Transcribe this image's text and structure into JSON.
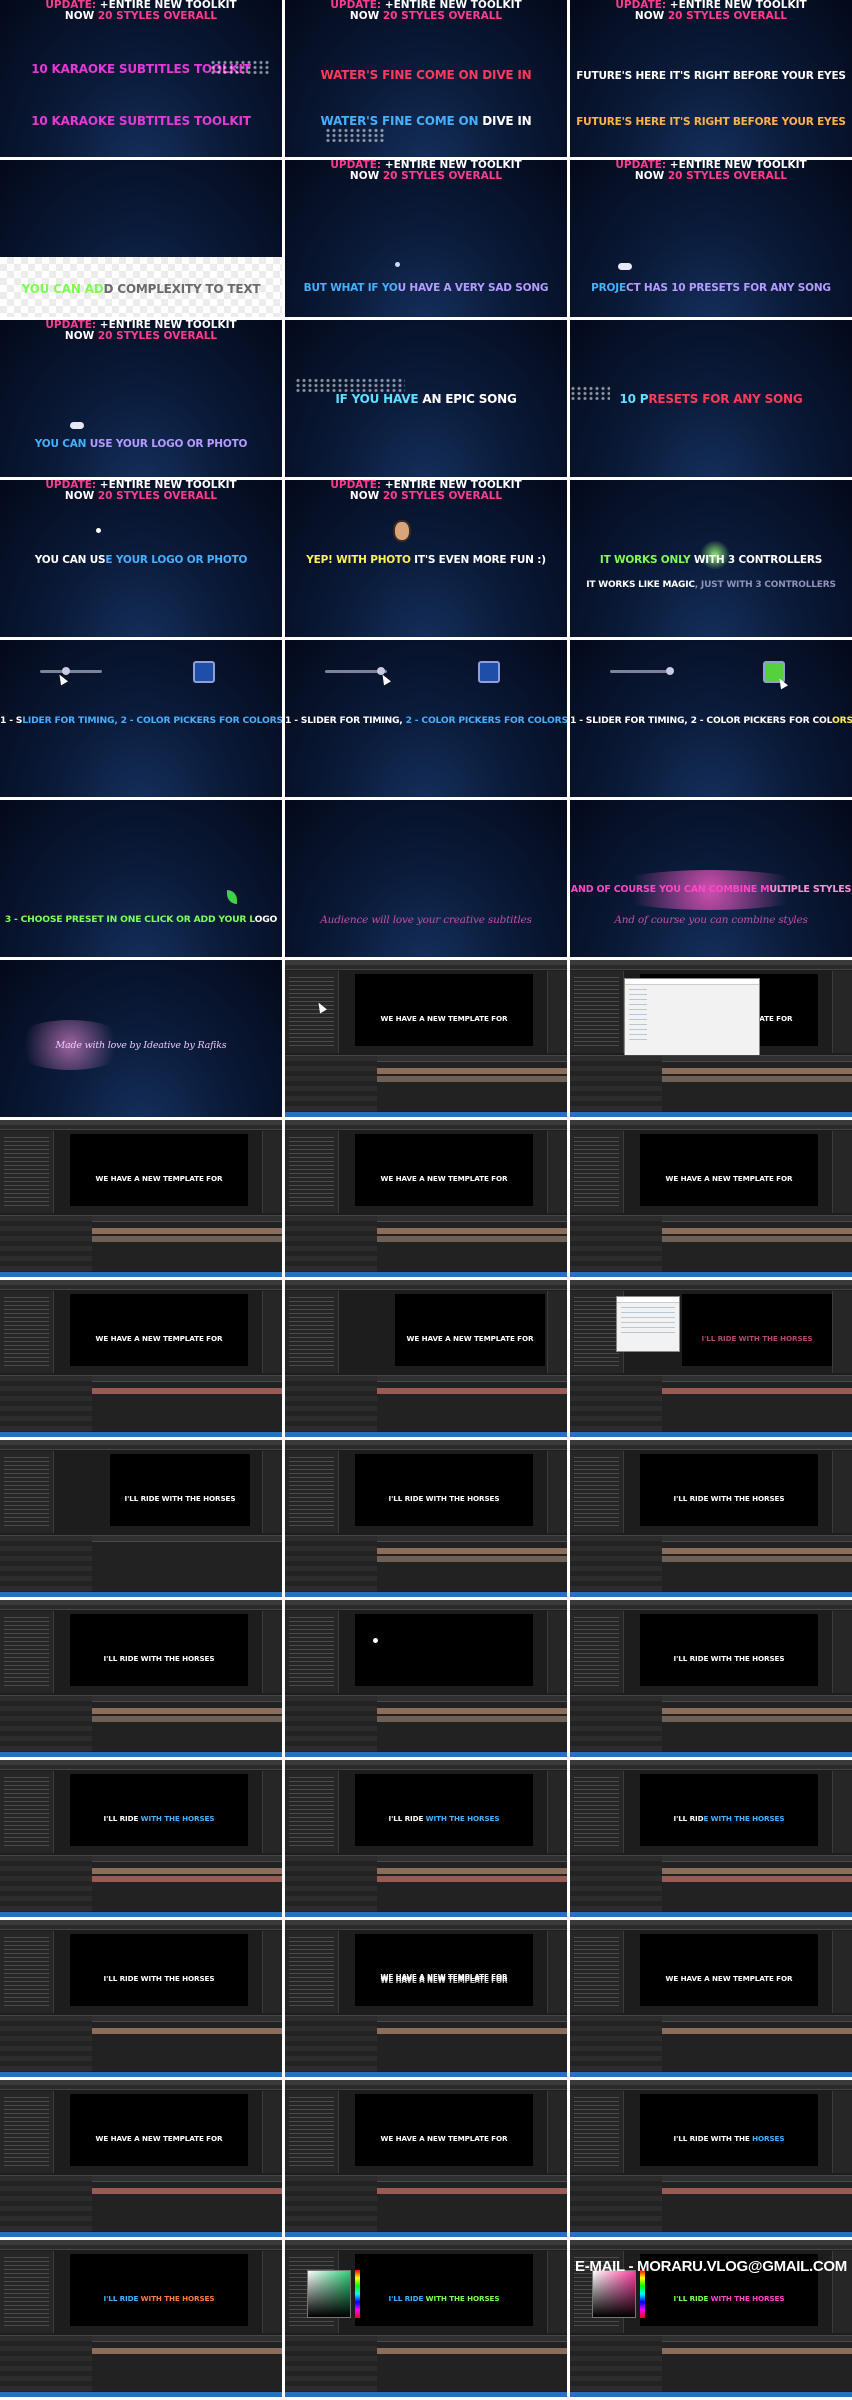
{
  "update_banner": {
    "prefix": "UPDATE:",
    "line1_rest": " +ENTIRE NEW TOOLKIT",
    "line2_now": "NOW ",
    "line2_styles": "20 STYLES OVERALL"
  },
  "promo": {
    "r1c1": {
      "top": "10 KARAOKE SUBTITLES TOOLKIT",
      "bottom": "10 KARAOKE SUBTITLES TOOLKIT"
    },
    "r1c2": {
      "top": "WATER'S FINE COME ON DIVE IN",
      "bottom_a": "WATER'S FINE COME ON",
      "bottom_b": " DIVE IN"
    },
    "r1c3": {
      "top": "FUTURE'S HERE IT'S RIGHT BEFORE YOUR EYES",
      "bottom": "FUTURE'S HERE IT'S RIGHT BEFORE YOUR EYES"
    },
    "r2c1": {
      "a": "YOU CAN AD",
      "b": "D COMPLEXITY TO TEXT"
    },
    "r2c2": {
      "a": "BUT WHAT IF YO",
      "b": "U HAVE A VERY SAD SONG"
    },
    "r2c3": {
      "a": "PROJE",
      "b": "CT HAS 10 PRESETS FOR ANY SONG"
    },
    "r3c1": {
      "a": "YOU CAN",
      "b": " USE YOUR LOGO OR PHOTO"
    },
    "r3c2": {
      "a": "IF YOU HAVE",
      "b": " AN EPIC SONG"
    },
    "r3c3": {
      "a": "10 P",
      "b": "RESETS FOR ANY SONG"
    },
    "r4c1": {
      "a": "YOU CAN US",
      "b": "E YOUR LOGO OR PHOTO"
    },
    "r4c2": {
      "a": "YEP! WITH PHOTO",
      "b": " IT'S EVEN MORE FUN :)"
    },
    "r4c3": {
      "top_a": "IT WORKS ONLY ",
      "top_b": "WITH 3 CONTROLLERS",
      "bottom_a": "IT WORKS LIKE MAGIC",
      "bottom_b": ", JUST WITH 3 CONTROLLERS"
    },
    "r5c1": {
      "a": "1 - S",
      "b": "LIDER FOR TIMING, 2 - COLOR PICKERS FOR COLORS"
    },
    "r5c2": {
      "a": "1 - SLIDER FOR TIMING, ",
      "b": "2 - COLOR PICKERS FOR COLORS"
    },
    "r5c3": {
      "a": "1 - SLIDER FOR TIMING, 2 - COLOR PICKERS FOR COL",
      "b": "ORS"
    },
    "r6c1": {
      "a": "3 - CHOOSE PRESET IN ONE CLICK OR ADD YOUR L",
      "b": "OGO"
    },
    "r6c2": {
      "text": "Audience will love your creative subtitles"
    },
    "r6c3": {
      "top_a": "AND OF COURSE YOU CAN COMBINE M",
      "top_b": "ULTIPLE STYLES",
      "bottom": "And of course you can combine styles"
    },
    "r7c1": {
      "text": "Made with love by Ideative by Rafiks"
    }
  },
  "editor": {
    "template_text": "WE HAVE A NEW TEMPLATE FOR",
    "template_text_glitch": "WE HAVE A NEW TEMPLATE FOR",
    "horses_text": "I'LL RIDE WITH THE HORSES",
    "horses_a": "I'LL RIDE ",
    "horses_b": "WITH THE HORSES",
    "horses_c": "I'LL RID",
    "horses_d": "E WITH THE HORSES",
    "horses_e": "I'LL RIDE WITH THE ",
    "horses_f": "HORSES",
    "email": "E-MAIL - MORARU.VLOG@GMAIL.COM"
  },
  "colors": {
    "promo_bg": "#04091a",
    "editor_bg": "#1d1d1d",
    "accent_pink": "#ff46c8",
    "accent_blue": "#46b0ff",
    "status_blue": "#2d6fbf"
  }
}
